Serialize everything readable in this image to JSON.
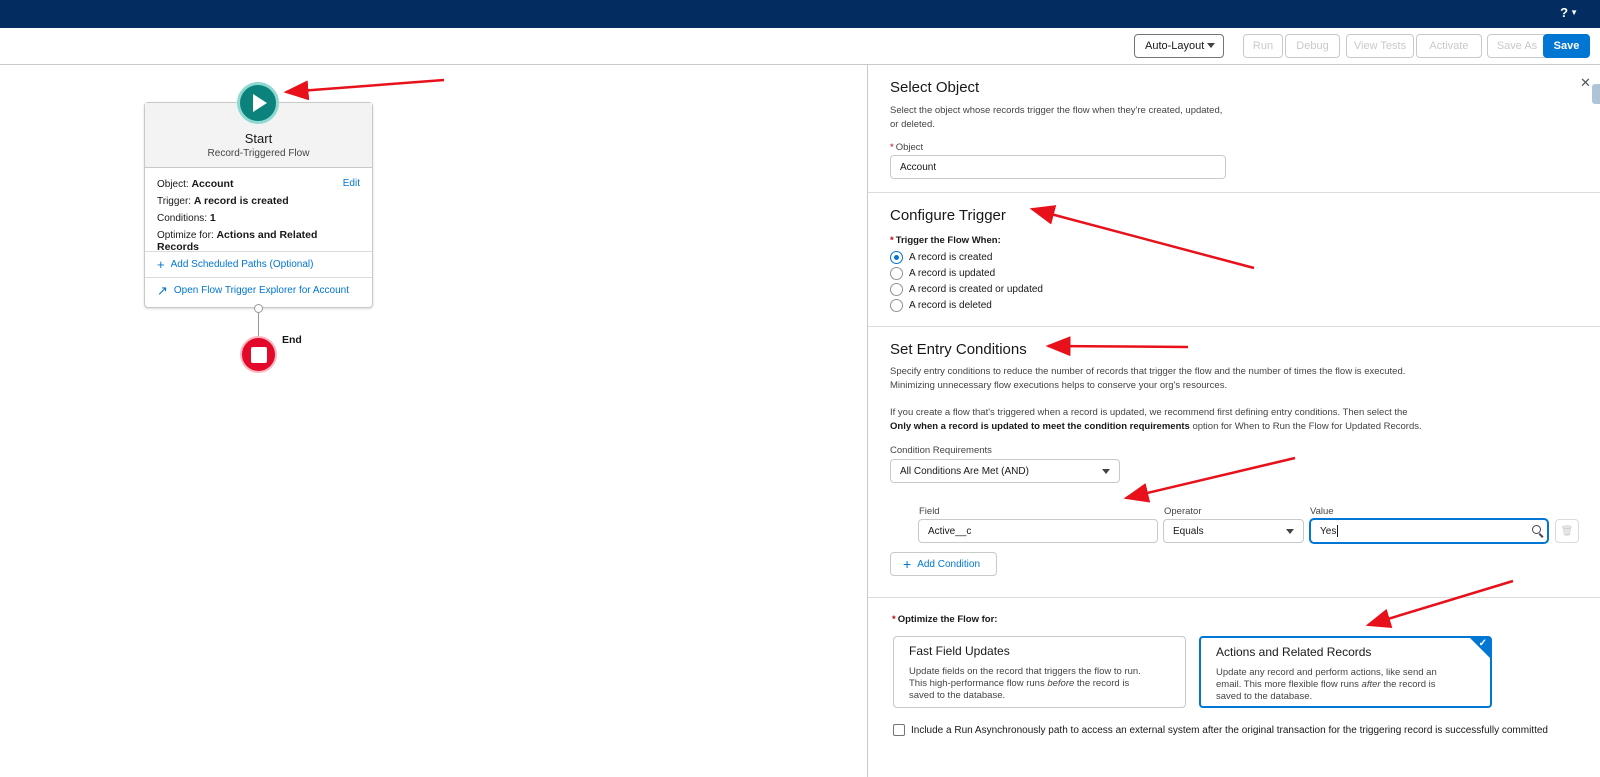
{
  "header": {
    "help_label": "?"
  },
  "toolbar": {
    "layout_select": "Auto-Layout",
    "run": "Run",
    "debug": "Debug",
    "view_tests": "View Tests",
    "activate": "Activate",
    "save_as": "Save As",
    "save": "Save"
  },
  "canvas": {
    "start": {
      "title": "Start",
      "subtitle": "Record-Triggered Flow",
      "object_label": "Object:",
      "object_value": "Account",
      "edit": "Edit",
      "trigger_label": "Trigger:",
      "trigger_value": "A record is created",
      "conditions_label": "Conditions:",
      "conditions_value": "1",
      "optimize_label": "Optimize for:",
      "optimize_value": "Actions and Related Records",
      "add_scheduled": "Add Scheduled Paths (Optional)",
      "open_explorer": "Open Flow Trigger Explorer for Account"
    },
    "end_label": "End"
  },
  "panel": {
    "select_object": {
      "heading": "Select Object",
      "description": "Select the object whose records trigger the flow when they're created, updated, or deleted.",
      "object_label": "Object",
      "object_value": "Account"
    },
    "configure_trigger": {
      "heading": "Configure Trigger",
      "trigger_label": "Trigger the Flow When:",
      "options": [
        "A record is created",
        "A record is updated",
        "A record is created or updated",
        "A record is deleted"
      ],
      "selected_index": 0
    },
    "entry_conditions": {
      "heading": "Set Entry Conditions",
      "desc_1": "Specify entry conditions to reduce the number of records that trigger the flow and the number of times the flow is executed.",
      "desc_2": "Minimizing unnecessary flow executions helps to conserve your org's resources.",
      "desc_3": "If you create a flow that's triggered when a record is updated, we recommend first defining entry conditions. Then select the",
      "desc_4_bold": "Only when a record is updated to meet the condition requirements",
      "desc_4_rest": " option for When to Run the Flow for Updated Records.",
      "requirements_label": "Condition Requirements",
      "requirements_value": "All Conditions Are Met (AND)",
      "field_label": "Field",
      "field_value": "Active__c",
      "operator_label": "Operator",
      "operator_value": "Equals",
      "value_label": "Value",
      "value_value": "Yes",
      "add_condition": "Add Condition"
    },
    "optimize": {
      "label": "Optimize the Flow for:",
      "fast": {
        "title": "Fast Field Updates",
        "line1": "Update fields on the record that triggers the flow to run.",
        "line2_a": "This high-performance flow runs ",
        "line2_em": "before",
        "line2_b": " the record is",
        "line3": "saved to the database."
      },
      "actions": {
        "title": "Actions and Related Records",
        "line1": "Update any record and perform actions, like send an",
        "line2_a": "email. This more flexible flow runs ",
        "line2_em": "after",
        "line2_b": " the record is",
        "line3": "saved to the database."
      },
      "selected": "actions"
    },
    "async_label": "Include a Run Asynchronously path to access an external system after the original transaction for the triggering record is successfully committed"
  },
  "colors": {
    "header": "#032d60",
    "brand": "#0176d3",
    "start": "#0b827c",
    "end": "#e3092a",
    "annotation": "#e8111b"
  }
}
